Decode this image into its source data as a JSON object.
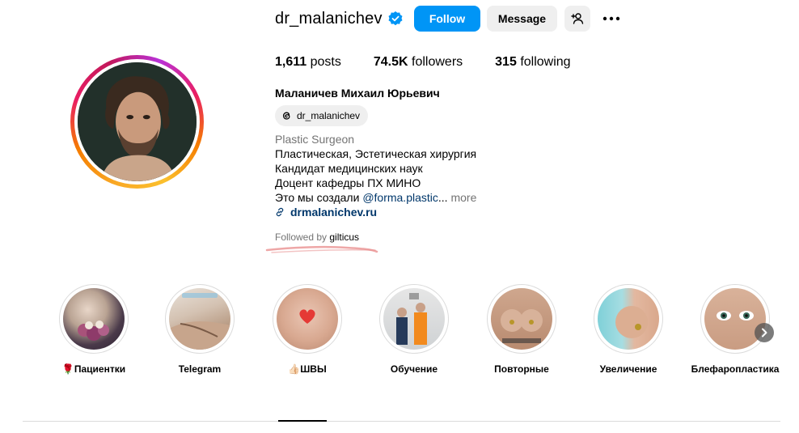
{
  "profile": {
    "username": "dr_malanichev",
    "verified_icon": "verified-badge-icon",
    "follow_label": "Follow",
    "message_label": "Message",
    "add_user_icon": "add-user-icon",
    "more_icon": "more-options-icon"
  },
  "stats": {
    "posts_count": "1,611",
    "posts_label": "posts",
    "followers_count": "74.5K",
    "followers_label": "followers",
    "following_count": "315",
    "following_label": "following"
  },
  "bio": {
    "full_name": "Маланичев Михаил Юрьевич",
    "threads_handle": "dr_malanichev",
    "category": "Plastic Surgeon",
    "line1": "Пластическая, Эстетическая хирургия",
    "line2": "Кандидат медицинских наук",
    "line3": "Доцент кафедры ПХ МИНО",
    "line4_prefix": "Это мы создали ",
    "line4_mention": "@forma.plastic",
    "line4_ellipsis": "...",
    "more_label": "more",
    "link": "drmalanichev.ru",
    "followed_by_prefix": "Followed by ",
    "followed_by_name": "gilticus"
  },
  "highlights": [
    {
      "label": "🌹Пациентки"
    },
    {
      "label": "Telegram"
    },
    {
      "label": "👍🏻ШВЫ"
    },
    {
      "label": "Обучение"
    },
    {
      "label": "Повторные"
    },
    {
      "label": "Увеличение"
    },
    {
      "label": "Блефаропластика"
    }
  ],
  "colors": {
    "accent": "#0095f6",
    "link": "#00376b",
    "muted": "#737373",
    "button_bg": "#efefef"
  }
}
